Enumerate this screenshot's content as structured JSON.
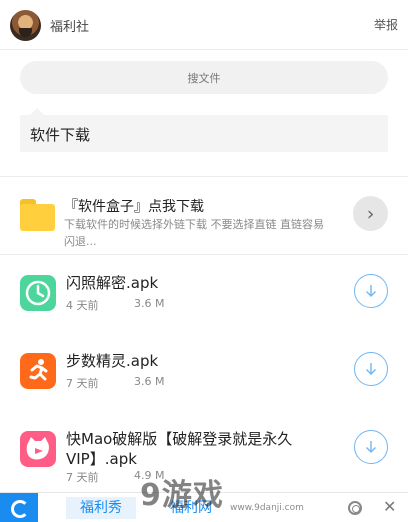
{
  "header": {
    "title": "福利社",
    "report": "举报"
  },
  "search": {
    "label": "搜文件"
  },
  "message": {
    "text": "软件下载"
  },
  "folder": {
    "title": "『软件盒子』点我下载",
    "desc": "下载软件的时候选择外链下载 不要选择直链 直链容易闪退..."
  },
  "files": [
    {
      "name": "闪照解密.apk",
      "age": "4 天前",
      "size": "3.6 M",
      "icon": "clock-app-icon",
      "color": "#4cd69b"
    },
    {
      "name": "步数精灵.apk",
      "age": "7 天前",
      "size": "3.6 M",
      "icon": "runner-app-icon",
      "color": "#ff6a1a"
    },
    {
      "name": "快Mao破解版【破解登录就是永久VIP】.apk",
      "age": "7 天前",
      "size": "4.9 M",
      "icon": "cat-app-icon",
      "color": "#ff5d86"
    }
  ],
  "bottom": {
    "tab1": "福利秀",
    "tab2": "福利网"
  },
  "watermark": {
    "main": "9游戏",
    "sub": "www.9danji.com"
  },
  "colors": {
    "accent": "#1a8cf0",
    "download_ring": "#6fb6f5"
  }
}
